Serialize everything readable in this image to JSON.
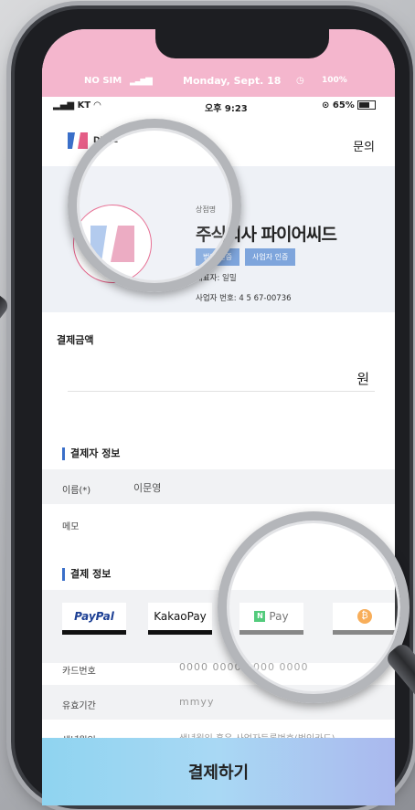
{
  "pink_status": {
    "nosim": "NO SIM",
    "date": "Monday, Sept. 18",
    "battery": "100%"
  },
  "status_bar": {
    "carrier": "KT",
    "time": "오후 9:23",
    "battery": "65%"
  },
  "header": {
    "logo_text": "DENL",
    "inquiry": "문의"
  },
  "merchant": {
    "label": "상점명",
    "name": "주식회사 파이어씨드",
    "badges": [
      "법인 인증",
      "사업자 인증"
    ],
    "ceo": "대표자: 일밀",
    "biz_no": "사업자 번호: 4 5 67-00736"
  },
  "amount": {
    "title": "결제금액",
    "unit": "원"
  },
  "payer": {
    "title": "결제자 정보",
    "rows": [
      {
        "label": "이름(*)",
        "value": "이문영"
      },
      {
        "label": "메모",
        "value": ""
      }
    ]
  },
  "payment": {
    "title": "결제 정보",
    "methods": [
      "PayPal",
      "KakaoPay",
      "Pay",
      "₿"
    ],
    "rows": [
      {
        "label": "카드번호",
        "value": "0000  0000  0000  0000"
      },
      {
        "label": "유효기간",
        "value": "mmyy"
      },
      {
        "label": "생년월일",
        "value": "생년월일 혹은 사업자등록번호(법인카드)"
      }
    ]
  },
  "cta": {
    "label": "결제하기"
  }
}
